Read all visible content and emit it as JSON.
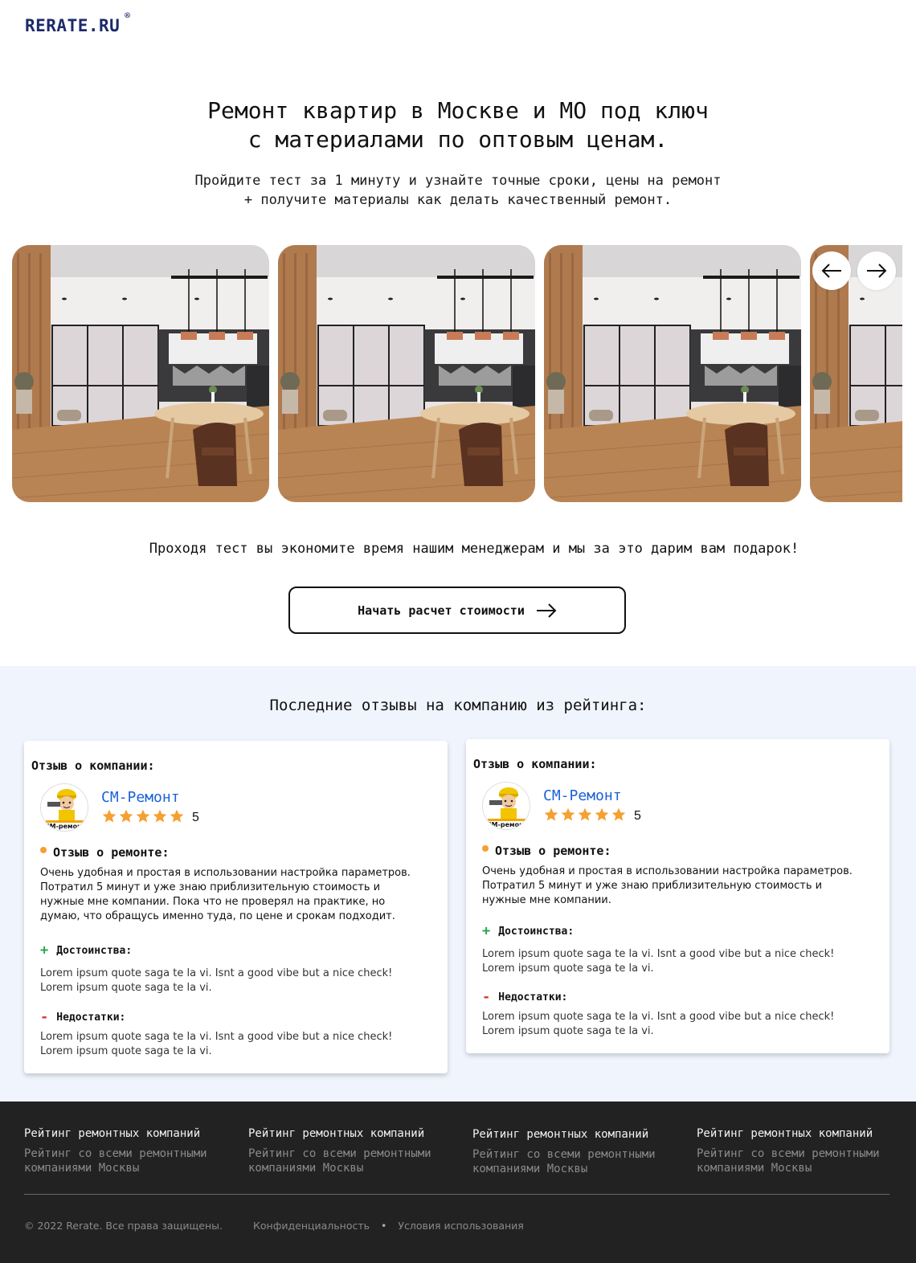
{
  "header": {
    "logo": "RERATE.RU",
    "logo_mark": "®"
  },
  "hero": {
    "title_line1": "Ремонт квартир в Москве и МО под ключ",
    "title_line2": "с материалами по оптовым ценам.",
    "subtitle_line1": "Пройдите тест за 1 минуту и узнайте точные сроки, цены на ремонт",
    "subtitle_line2": "+ получите материалы как делать качественный ремонт."
  },
  "carousel": {
    "prev_icon": "arrow-left-icon",
    "next_icon": "arrow-right-icon",
    "slide_count_visible": 4
  },
  "gift_text": "Проходя тест вы экономите время нашим менеджерам и мы за это дарим вам подарок!",
  "cta": {
    "label": "Начать расчет стоимости",
    "icon": "arrow-right-icon"
  },
  "reviews": {
    "heading": "Последние отзывы на компанию из рейтинга:",
    "items": [
      {
        "card_title": "Отзыв о компании:",
        "company": "СМ-Ремонт",
        "rating": "5",
        "review_label": "Отзыв о ремонте:",
        "review_text": "Очень удобная и простая в использовании настройка параметров. Потратил 5 минут и уже знаю приблизительную стоимость и нужные мне компании. Пока что не проверял на практике, но думаю, что обращусь именно туда, по цене и срокам подходит.",
        "pros_label": "Достоинства:",
        "pros_text": "Lorem ipsum quote saga te la vi. Isnt a good vibe but a nice check! Lorem ipsum quote saga te la vi.",
        "cons_label": "Недостатки:",
        "cons_text": "Lorem ipsum quote saga te la vi. Isnt a good vibe but a nice check! Lorem ipsum quote saga te la vi."
      },
      {
        "card_title": "Отзыв о компании:",
        "company": "СМ-Ремонт",
        "rating": "5",
        "review_label": "Отзыв о ремонте:",
        "review_text": "Очень удобная и простая в использовании настройка параметров. Потратил 5 минут и уже знаю приблизительную стоимость и нужные мне компании.",
        "pros_label": "Достоинства:",
        "pros_text": "Lorem ipsum quote saga te la vi. Isnt a good vibe but a nice check! Lorem ipsum quote saga te la vi.",
        "cons_label": "Недостатки:",
        "cons_text": "Lorem ipsum quote saga te la vi. Isnt a good vibe but a nice check! Lorem ipsum quote saga te la vi."
      }
    ]
  },
  "footer": {
    "columns": [
      {
        "title": "Рейтинг ремонтных компаний",
        "text": "Рейтинг со всеми ремонтными компаниями Москвы"
      },
      {
        "title": "Рейтинг ремонтных компаний",
        "text": "Рейтинг со всеми ремонтными компаниями Москвы"
      },
      {
        "title": "Рейтинг ремонтных компаний",
        "text": "Рейтинг со всеми ремонтными компаниями Москвы"
      },
      {
        "title": "Рейтинг ремонтных компаний",
        "text": "Рейтинг со всеми ремонтными компаниями Москвы"
      }
    ],
    "copyright": "© 2022 Rerate. Все права защищены.",
    "link_privacy": "Конфиденциальность",
    "separator": "•",
    "link_terms": "Условия использования"
  },
  "colors": {
    "logo": "#1c2a6b",
    "company_link": "#1a62d6",
    "star": "#f5a030",
    "reviews_bg": "#eff4fd",
    "footer_bg": "#222222",
    "pros": "#2aa84a",
    "cons": "#d9362c"
  }
}
